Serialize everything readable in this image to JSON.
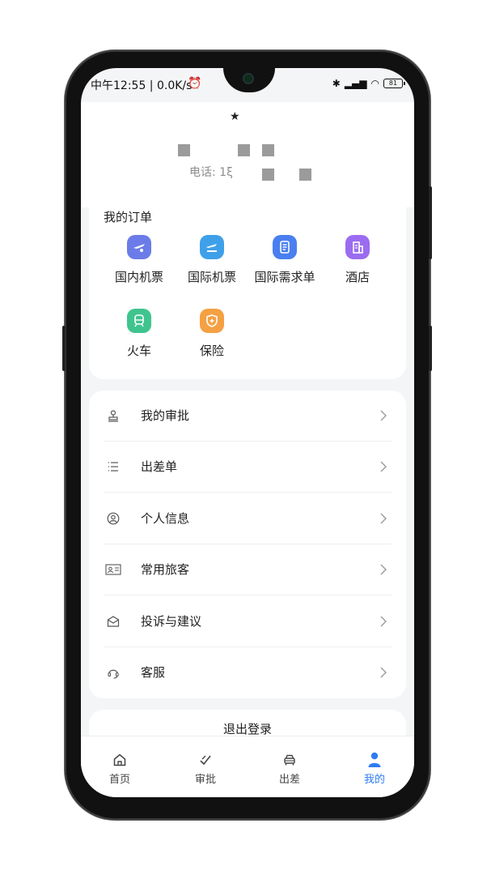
{
  "status_bar": {
    "time": "中午12:55 | 0.0K/s",
    "battery": "81"
  },
  "profile": {
    "mark": "★",
    "phone_label": "电话: 1ξ"
  },
  "orders": {
    "title": "我的订单",
    "items": [
      {
        "label": "国内机票",
        "icon": "domestic-flight-icon",
        "color": "#6b7ce8"
      },
      {
        "label": "国际机票",
        "icon": "international-flight-icon",
        "color": "#3fa0ea"
      },
      {
        "label": "国际需求单",
        "icon": "requirement-doc-icon",
        "color": "#4a7ff0"
      },
      {
        "label": "酒店",
        "icon": "hotel-icon",
        "color": "#9b6cf0"
      },
      {
        "label": "火车",
        "icon": "train-icon",
        "color": "#3fc48e"
      },
      {
        "label": "保险",
        "icon": "insurance-icon",
        "color": "#f5a043"
      }
    ]
  },
  "menu": {
    "items": [
      {
        "label": "我的审批",
        "icon": "stamp-icon"
      },
      {
        "label": "出差单",
        "icon": "list-icon"
      },
      {
        "label": "个人信息",
        "icon": "user-circle-icon"
      },
      {
        "label": "常用旅客",
        "icon": "id-card-icon"
      },
      {
        "label": "投诉与建议",
        "icon": "envelope-icon"
      },
      {
        "label": "客服",
        "icon": "headset-icon"
      }
    ]
  },
  "logout_label": "退出登录",
  "tabbar": {
    "tabs": [
      {
        "label": "首页",
        "icon": "home-icon"
      },
      {
        "label": "审批",
        "icon": "approve-icon"
      },
      {
        "label": "出差",
        "icon": "car-icon"
      },
      {
        "label": "我的",
        "icon": "person-icon",
        "active": true
      }
    ]
  },
  "colors": {
    "accent": "#2e7cf0",
    "background": "#f4f5f7"
  }
}
